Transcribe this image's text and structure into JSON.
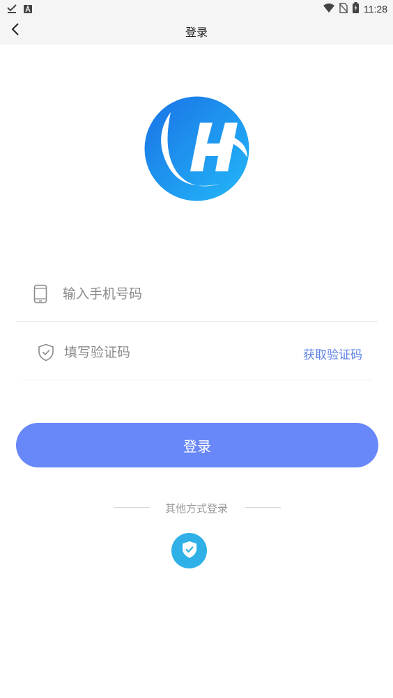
{
  "status_bar": {
    "time": "11:28",
    "icons": [
      "download-done-icon",
      "keyboard-a-icon",
      "wifi-icon",
      "no-sim-icon",
      "battery-charging-icon"
    ]
  },
  "nav": {
    "title": "登录",
    "back_icon": "chevron-left-icon"
  },
  "logo": {
    "name": "app-logo",
    "colors": [
      "#1e7fe8",
      "#23b6f6"
    ]
  },
  "form": {
    "phone": {
      "placeholder": "输入手机号码",
      "value": "",
      "icon": "phone-icon"
    },
    "code": {
      "placeholder": "填写验证码",
      "value": "",
      "icon": "shield-icon"
    },
    "get_code_label": "获取验证码"
  },
  "login_button": {
    "label": "登录",
    "color": "#6887f8"
  },
  "other_login": {
    "label": "其他方式登录",
    "methods": [
      {
        "icon": "shield-check-icon",
        "color": "#2fb1e8"
      }
    ]
  },
  "colors": {
    "accent": "#5b80e6"
  }
}
